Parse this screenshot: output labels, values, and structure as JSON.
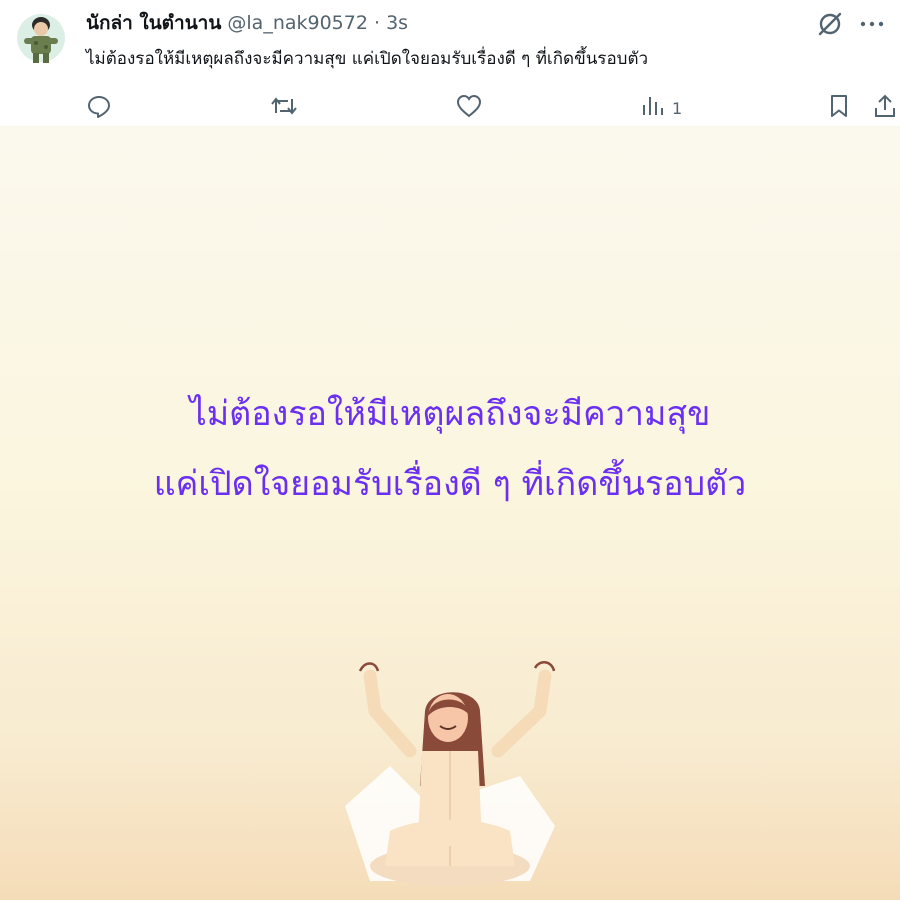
{
  "post": {
    "display_name": "นักล่า ในตำนาน",
    "handle": "@la_nak90572",
    "separator": "·",
    "time": "3s",
    "text": "ไม่ต้องรอให้มีเหตุผลถึงจะมีความสุข แค่เปิดใจยอมรับเรื่องดี ๆ ที่เกิดขึ้นรอบตัว"
  },
  "actions": {
    "views_count": "1"
  },
  "media": {
    "line1": "ไม่ต้องรอให้มีเหตุผลถึงจะมีความสุข",
    "line2": "แค่เปิดใจยอมรับเรื่องดี ๆ ที่เกิดขึ้นรอบตัว"
  },
  "icons": {
    "grok": "grok-icon",
    "more": "more-icon",
    "reply": "reply-icon",
    "repost": "repost-icon",
    "like": "like-icon",
    "views": "views-icon",
    "bookmark": "bookmark-icon",
    "share": "share-icon"
  },
  "colors": {
    "text_primary": "#0f1419",
    "text_secondary": "#536471",
    "quote_purple": "#6a2ff0"
  }
}
